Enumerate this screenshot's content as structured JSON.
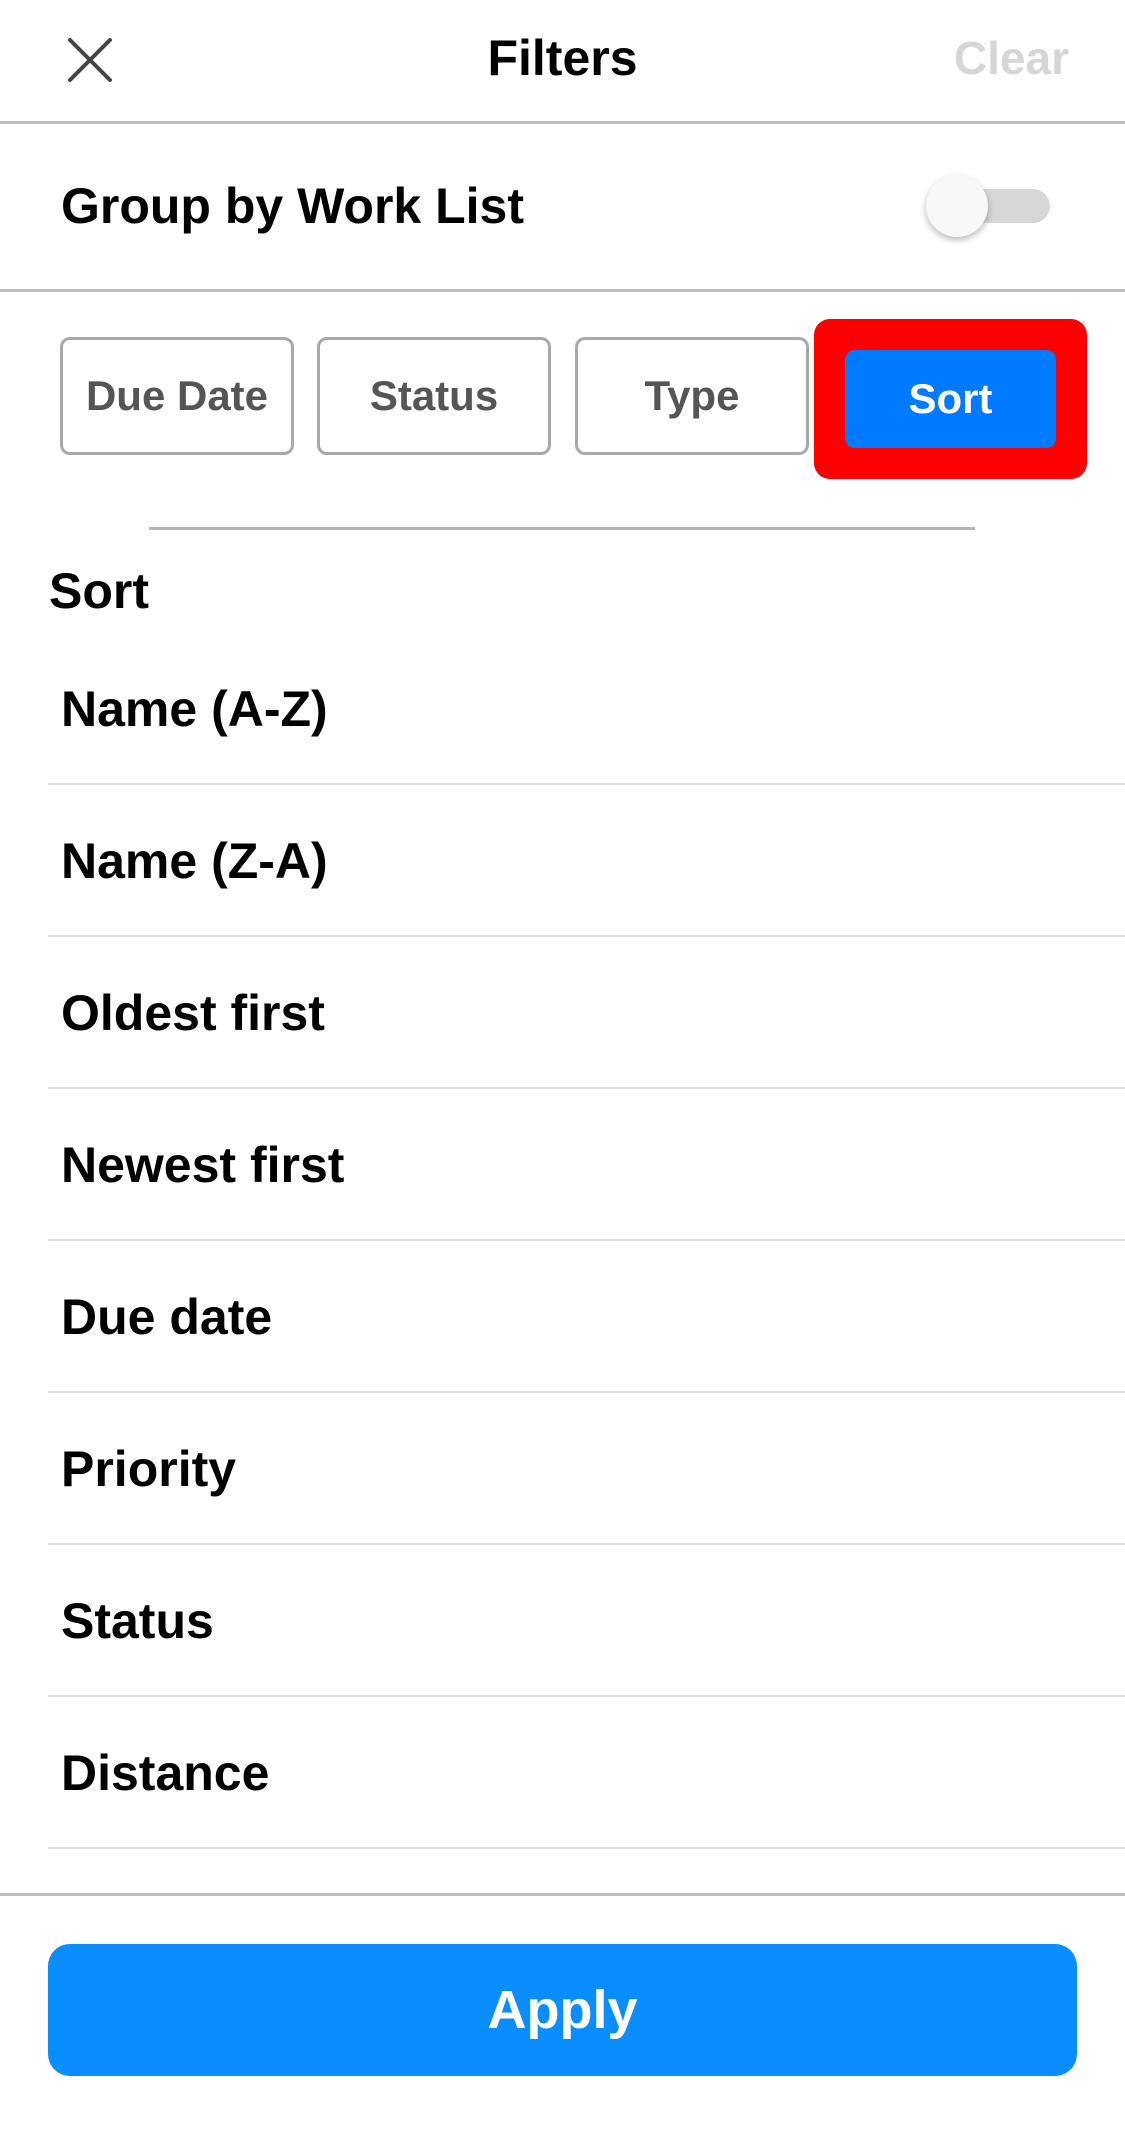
{
  "header": {
    "close_icon": "close-icon",
    "title": "Filters",
    "clear_label": "Clear"
  },
  "group_by": {
    "label": "Group by Work List",
    "enabled": false
  },
  "tabs": [
    {
      "label": "Due Date",
      "active": false
    },
    {
      "label": "Status",
      "active": false
    },
    {
      "label": "Type",
      "active": false
    },
    {
      "label": "Sort",
      "active": true
    }
  ],
  "sort": {
    "title": "Sort",
    "options": [
      "Name (A-Z)",
      "Name (Z-A)",
      "Oldest first",
      "Newest first",
      "Due date",
      "Priority",
      "Status",
      "Distance"
    ]
  },
  "footer": {
    "apply_label": "Apply"
  },
  "colors": {
    "accent": "#0a84ff",
    "active_tab": "#007aff",
    "highlight": "#ff0000",
    "disabled_text": "#d6d6d6",
    "icon": "#444444"
  }
}
